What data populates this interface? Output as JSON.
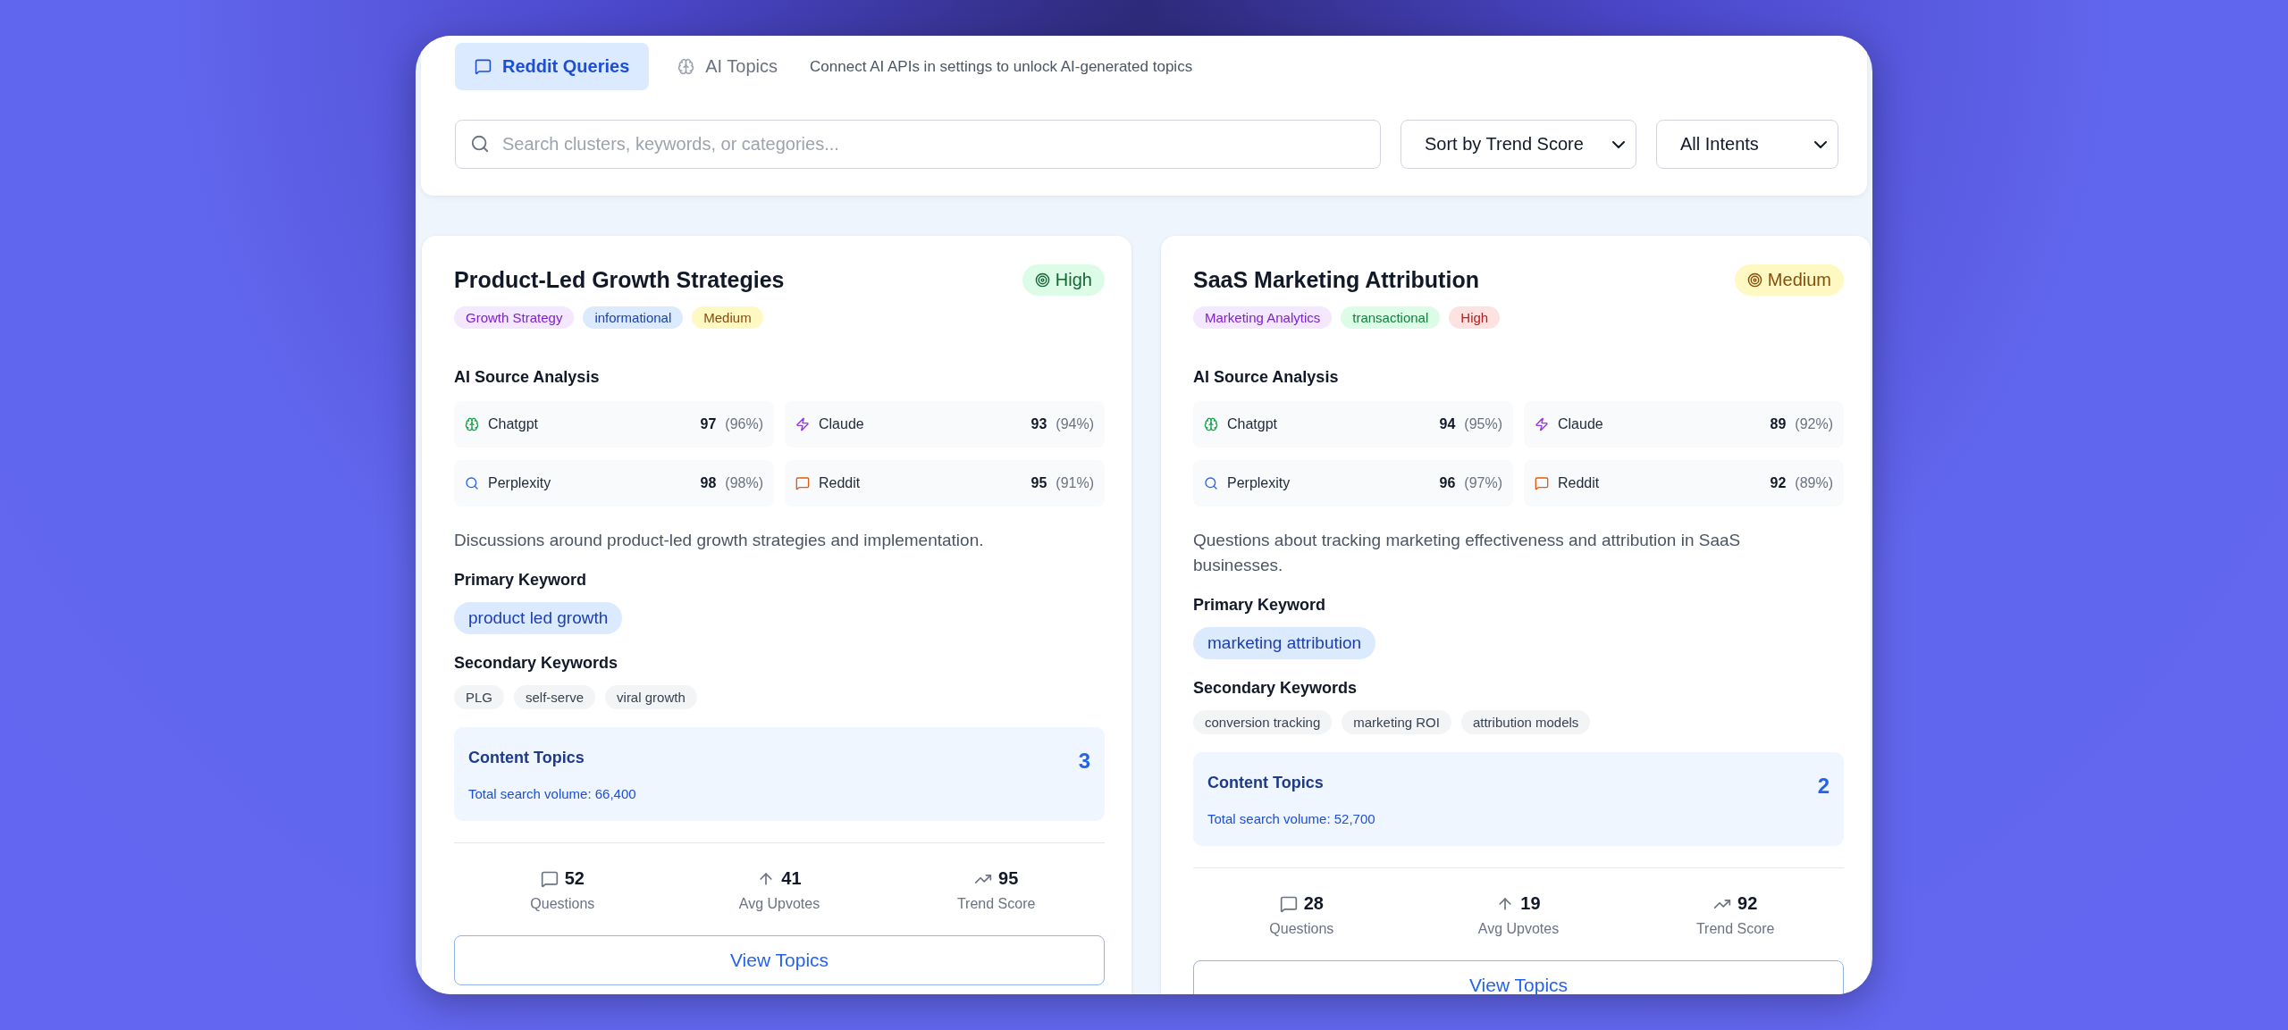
{
  "tabs": [
    {
      "label": "Reddit Queries",
      "selected": true,
      "kind": "chat"
    },
    {
      "label": "AI Topics",
      "selected": false,
      "kind": "brain"
    }
  ],
  "tabs_hint": "Connect AI APIs in settings to unlock AI-generated topics",
  "search": {
    "placeholder": "Search clusters, keywords, or categories..."
  },
  "filters": [
    {
      "value": "Sort by Trend Score"
    },
    {
      "value": "All Intents"
    }
  ],
  "clusters": [
    {
      "title": "Product-Led Growth Strategies",
      "badge": {
        "label": "High",
        "color": "#166534"
      },
      "tags": [
        {
          "label": "Growth Strategy",
          "color": "#7e22ce"
        },
        {
          "label": "informational",
          "color": "#1e40af"
        },
        {
          "label": "Medium",
          "color": "#854d0e"
        }
      ],
      "sources_heading": "AI Source Analysis",
      "sources": [
        {
          "kind": "brain",
          "name": "Chatgpt",
          "score": "97",
          "share": "(96%)"
        },
        {
          "kind": "bolt",
          "name": "Claude",
          "score": "93",
          "share": "(94%)"
        },
        {
          "kind": "search",
          "name": "Perplexity",
          "score": "98",
          "share": "(98%)"
        },
        {
          "kind": "chat",
          "name": "Reddit",
          "score": "95",
          "share": "(91%)"
        }
      ],
      "description": "Discussions around product-led growth strategies and implementation.",
      "primary_heading": "Primary Keyword",
      "primary_keyword": "product led growth",
      "secondary_heading": "Secondary Keywords",
      "secondary_keywords": [
        "PLG",
        "self-serve",
        "viral growth"
      ],
      "topics": {
        "title": "Content Topics",
        "count": "3",
        "volume": "Total search volume: 66,400"
      },
      "stats": [
        {
          "kind": "questions",
          "value": "52",
          "label": "Questions"
        },
        {
          "kind": "upvotes",
          "value": "41",
          "label": "Avg Upvotes"
        },
        {
          "kind": "trend",
          "value": "95",
          "label": "Trend Score"
        }
      ],
      "button": "View Topics"
    },
    {
      "title": "SaaS Marketing Attribution",
      "badge": {
        "label": "Medium",
        "color": "#854d0e"
      },
      "tags": [
        {
          "label": "Marketing Analytics",
          "color": "#7e22ce"
        },
        {
          "label": "transactional",
          "color": "#15803d"
        },
        {
          "label": "High",
          "color": "#b91c1c"
        }
      ],
      "sources_heading": "AI Source Analysis",
      "sources": [
        {
          "kind": "brain",
          "name": "Chatgpt",
          "score": "94",
          "share": "(95%)"
        },
        {
          "kind": "bolt",
          "name": "Claude",
          "score": "89",
          "share": "(92%)"
        },
        {
          "kind": "search",
          "name": "Perplexity",
          "score": "96",
          "share": "(97%)"
        },
        {
          "kind": "chat",
          "name": "Reddit",
          "score": "92",
          "share": "(89%)"
        }
      ],
      "description": "Questions about tracking marketing effectiveness and attribution in SaaS businesses.",
      "primary_heading": "Primary Keyword",
      "primary_keyword": "marketing attribution",
      "secondary_heading": "Secondary Keywords",
      "secondary_keywords": [
        "conversion tracking",
        "marketing ROI",
        "attribution models"
      ],
      "topics": {
        "title": "Content Topics",
        "count": "2",
        "volume": "Total search volume: 52,700"
      },
      "stats": [
        {
          "kind": "questions",
          "value": "28",
          "label": "Questions"
        },
        {
          "kind": "upvotes",
          "value": "19",
          "label": "Avg Upvotes"
        },
        {
          "kind": "trend",
          "value": "92",
          "label": "Trend Score"
        }
      ],
      "button": "View Topics"
    }
  ]
}
